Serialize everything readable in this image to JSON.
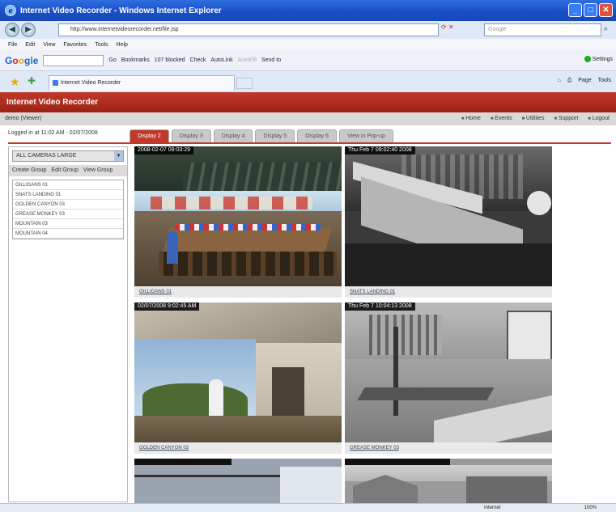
{
  "browser": {
    "title": "Internet Video Recorder - Windows Internet Explorer",
    "address": "http://www.internetvideorecorder.net/file.jsp",
    "search_placeholder": "Google",
    "menu": [
      "File",
      "Edit",
      "View",
      "Favorites",
      "Tools",
      "Help"
    ],
    "google_toolbar": {
      "logo": "Google",
      "items": [
        "Go",
        "Bookmarks",
        "107 blocked",
        "Check",
        "AutoLink",
        "AutoFill",
        "Send to"
      ],
      "settings": "Settings"
    },
    "tab_title": "Internet Video Recorder",
    "fav_right": [
      "Page",
      "Tools"
    ],
    "status_zone": "Internet",
    "status_zoom": "100%"
  },
  "app": {
    "header": "Internet Video Recorder",
    "user": "demo (Viewer)",
    "nav": [
      "Home",
      "Events",
      "Utilities",
      "Support",
      "Logout"
    ],
    "login_text": "Logged in at 11:02 AM - 02/07/2008",
    "tabs": [
      "Display 2",
      "Display 3",
      "Display 4",
      "Display 5",
      "Display 6",
      "View in Pop-up"
    ],
    "camera_select": "ALL CAMERAS LARGE",
    "group_actions": [
      "Create Group",
      "Edit Group",
      "View Group"
    ],
    "cameras": [
      "GILLIGANS 01",
      "SNATS LANDING 01",
      "GOLDEN CANYON 03",
      "GREASE MONKEY 03",
      "MOUNTAIN 03",
      "MOUNTAIN 04"
    ]
  },
  "tiles": [
    {
      "timestamp": "2008-02-07 09:03:29",
      "caption": "GILLIGANS 01"
    },
    {
      "timestamp": "Thu Feb  7 09:02:40 2008",
      "caption": "SNATS LANDING 01"
    },
    {
      "timestamp": "02/07/2008  9:02:45 AM",
      "caption": "GOLDEN CANYON 03"
    },
    {
      "timestamp": "Thu Feb  7 10:04:13 2008",
      "caption": "GREASE MONKEY 03"
    }
  ]
}
